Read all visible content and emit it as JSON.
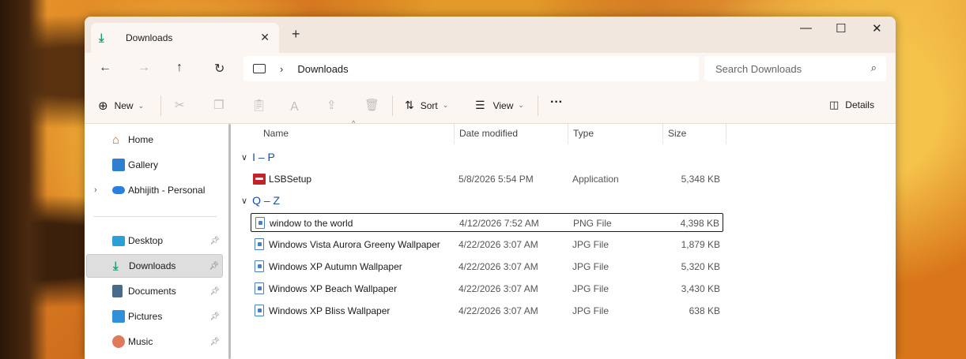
{
  "window": {
    "tab_title": "Downloads",
    "new_tab": "+",
    "minimize": "—",
    "maximize": "☐",
    "close": "✕"
  },
  "address": {
    "back": "←",
    "forward": "→",
    "up": "↑",
    "refresh": "↻",
    "separator": "›",
    "path": "Downloads",
    "search_placeholder": "Search Downloads"
  },
  "commands": {
    "new_label": "New",
    "sort_label": "Sort",
    "view_label": "View",
    "more": "···",
    "details_label": "Details"
  },
  "sidebar": {
    "items": [
      {
        "label": "Home",
        "icon": "home-icon"
      },
      {
        "label": "Gallery",
        "icon": "gallery-icon"
      },
      {
        "label": "Abhijith - Personal",
        "icon": "onedrive-icon"
      },
      {
        "label": "Desktop",
        "icon": "desktop-icon"
      },
      {
        "label": "Downloads",
        "icon": "download-icon"
      },
      {
        "label": "Documents",
        "icon": "documents-icon"
      },
      {
        "label": "Pictures",
        "icon": "pictures-icon"
      },
      {
        "label": "Music",
        "icon": "music-icon"
      }
    ]
  },
  "columns": {
    "name": "Name",
    "date_modified": "Date modified",
    "type": "Type",
    "size": "Size"
  },
  "groups": [
    {
      "label": "I – P",
      "files": [
        {
          "name": "LSBSetup",
          "date": "5/8/2026 5:54 PM",
          "type": "Application",
          "size": "5,348 KB"
        }
      ]
    },
    {
      "label": "Q – Z",
      "files": [
        {
          "name": "window to the world",
          "date": "4/12/2026 7:52 AM",
          "type": "PNG File",
          "size": "4,398 KB"
        },
        {
          "name": "Windows Vista Aurora Greeny Wallpaper",
          "date": "4/22/2026 3:07 AM",
          "type": "JPG File",
          "size": "1,879 KB"
        },
        {
          "name": "Windows XP Autumn Wallpaper",
          "date": "4/22/2026 3:07 AM",
          "type": "JPG File",
          "size": "5,320 KB"
        },
        {
          "name": "Windows XP Beach Wallpaper",
          "date": "4/22/2026 3:07 AM",
          "type": "JPG File",
          "size": "3,430 KB"
        },
        {
          "name": "Windows XP Bliss Wallpaper",
          "date": "4/22/2026 3:07 AM",
          "type": "JPG File",
          "size": "638 KB"
        }
      ]
    }
  ]
}
